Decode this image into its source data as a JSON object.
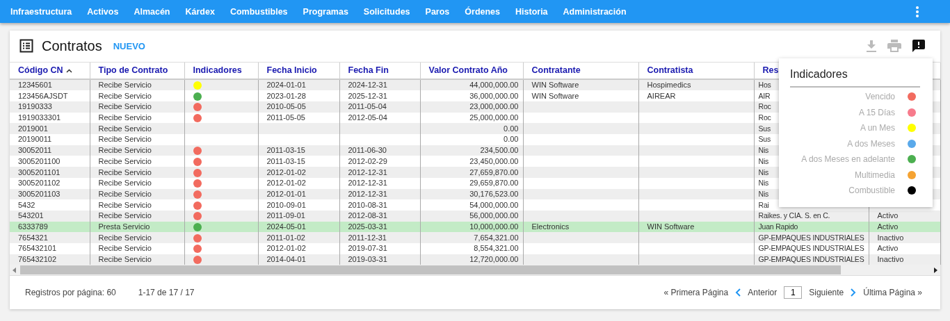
{
  "nav": {
    "items": [
      "Infraestructura",
      "Activos",
      "Almacén",
      "Kárdex",
      "Combustibles",
      "Programas",
      "Solicitudes",
      "Paros",
      "Órdenes",
      "Historia",
      "Administración"
    ]
  },
  "page": {
    "title": "Contratos",
    "new_button": "NUEVO"
  },
  "table": {
    "columns": [
      {
        "label": "Código CN",
        "sorted": true
      },
      {
        "label": "Tipo de Contrato",
        "sorted": false
      },
      {
        "label": "Indicadores",
        "sorted": false
      },
      {
        "label": "Fecha Inicio",
        "sorted": false
      },
      {
        "label": "Fecha Fin",
        "sorted": false
      },
      {
        "label": "Valor Contrato Año",
        "sorted": false
      },
      {
        "label": "Contratante",
        "sorted": false
      },
      {
        "label": "Contratista",
        "sorted": false
      },
      {
        "label": "Res",
        "sorted": false
      }
    ],
    "rows": [
      {
        "selected": false,
        "color": "#ffff00",
        "cells": [
          "12345601",
          "Recibe Servicio",
          "",
          "2024-01-01",
          "2024-12-31",
          "44,000,000.00",
          "WIN Software",
          "Hospimedics",
          "Hos"
        ]
      },
      {
        "selected": false,
        "color": "#4caf50",
        "cells": [
          "123456AJSDT",
          "Recibe Servicio",
          "",
          "2023-01-28",
          "2025-12-31",
          "36,000,000.00",
          "WIN Software",
          "AIREAR",
          "AIR"
        ]
      },
      {
        "selected": false,
        "color": "#f26b5f",
        "cells": [
          "19190333",
          "Recibe Servicio",
          "",
          "2010-05-05",
          "2011-05-04",
          "23,000,000.00",
          "",
          "",
          "Roc"
        ]
      },
      {
        "selected": false,
        "color": "#f26b5f",
        "cells": [
          "1919033301",
          "Recibe Servicio",
          "",
          "2011-05-05",
          "2012-05-04",
          "25,000,000.00",
          "",
          "",
          "Roc"
        ]
      },
      {
        "selected": false,
        "cells": [
          "2019001",
          "Recibe Servicio",
          "",
          "",
          "",
          "0.00",
          "",
          "",
          "Sus"
        ]
      },
      {
        "selected": false,
        "cells": [
          "20190011",
          "Recibe Servicio",
          "",
          "",
          "",
          "0.00",
          "",
          "",
          "Sus"
        ]
      },
      {
        "selected": false,
        "color": "#f26b5f",
        "cells": [
          "30052011",
          "Recibe Servicio",
          "",
          "2011-03-15",
          "2011-06-30",
          "234,500.00",
          "",
          "",
          "Nis"
        ]
      },
      {
        "selected": false,
        "color": "#f26b5f",
        "cells": [
          "3005201100",
          "Recibe Servicio",
          "",
          "2011-03-15",
          "2012-02-29",
          "23,450,000.00",
          "",
          "",
          "Nis"
        ]
      },
      {
        "selected": false,
        "color": "#f26b5f",
        "cells": [
          "3005201101",
          "Recibe Servicio",
          "",
          "2012-01-02",
          "2012-12-31",
          "27,659,870.00",
          "",
          "",
          "Nis"
        ]
      },
      {
        "selected": false,
        "color": "#f26b5f",
        "cells": [
          "3005201102",
          "Recibe Servicio",
          "",
          "2012-01-02",
          "2012-12-31",
          "29,659,870.00",
          "",
          "",
          "Nis"
        ]
      },
      {
        "selected": false,
        "color": "#f26b5f",
        "cells": [
          "3005201103",
          "Recibe Servicio",
          "",
          "2012-01-01",
          "2012-12-31",
          "30,176,523.00",
          "",
          "",
          "Nis"
        ]
      },
      {
        "selected": false,
        "color": "#f26b5f",
        "cells": [
          "5432",
          "Recibe Servicio",
          "",
          "2010-09-01",
          "2010-08-31",
          "54,000,000.00",
          "",
          "",
          "Rai"
        ]
      },
      {
        "selected": false,
        "color": "#f26b5f",
        "cells": [
          "543201",
          "Recibe Servicio",
          "",
          "2011-09-01",
          "2012-08-31",
          "56,000,000.00",
          "",
          "",
          "Raikes. y CIA. S. en C.",
          "Activo"
        ]
      },
      {
        "selected": true,
        "color": "#4caf50",
        "cells": [
          "6333789",
          "Presta Servicio",
          "",
          "2024-05-01",
          "2025-03-31",
          "10,000,000.00",
          "Electronics",
          "WIN Software",
          "Juan Rapido",
          "Activo"
        ]
      },
      {
        "selected": false,
        "color": "#f26b5f",
        "cells": [
          "7654321",
          "Recibe Servicio",
          "",
          "2011-01-02",
          "2011-12-31",
          "7,654,321.00",
          "",
          "",
          "GP-EMPAQUES INDUSTRIALES",
          "Inactivo"
        ]
      },
      {
        "selected": false,
        "color": "#f26b5f",
        "cells": [
          "765432101",
          "Recibe Servicio",
          "",
          "2012-01-02",
          "2019-07-31",
          "8,554,321.00",
          "",
          "",
          "GP-EMPAQUES INDUSTRIALES",
          "Activo"
        ]
      },
      {
        "selected": false,
        "color": "#f26b5f",
        "cells": [
          "765432102",
          "Recibe Servicio",
          "",
          "2014-04-01",
          "2019-03-31",
          "12,720,000.00",
          "",
          "",
          "GP-EMPAQUES INDUSTRIALES",
          "Inactivo"
        ]
      }
    ]
  },
  "legend": {
    "title": "Indicadores",
    "items": [
      {
        "label": "Vencido",
        "color": "#f26b5f"
      },
      {
        "label": "A 15 Días",
        "color": "#f77b8c"
      },
      {
        "label": "A un Mes",
        "color": "#ffff00"
      },
      {
        "label": "A dos Meses",
        "color": "#5aa9ea"
      },
      {
        "label": "A dos Meses en adelante",
        "color": "#4caf50"
      },
      {
        "label": "Multimedia",
        "color": "#f5a332"
      },
      {
        "label": "Combustible",
        "color": "#000000"
      }
    ]
  },
  "footer": {
    "page_size": "Registros por página: 60",
    "range": "1-17 de 17 / 17",
    "first": "« Primera Página",
    "previous": "Anterior",
    "page": "1",
    "next": "Siguiente",
    "last": "Última Página »"
  }
}
